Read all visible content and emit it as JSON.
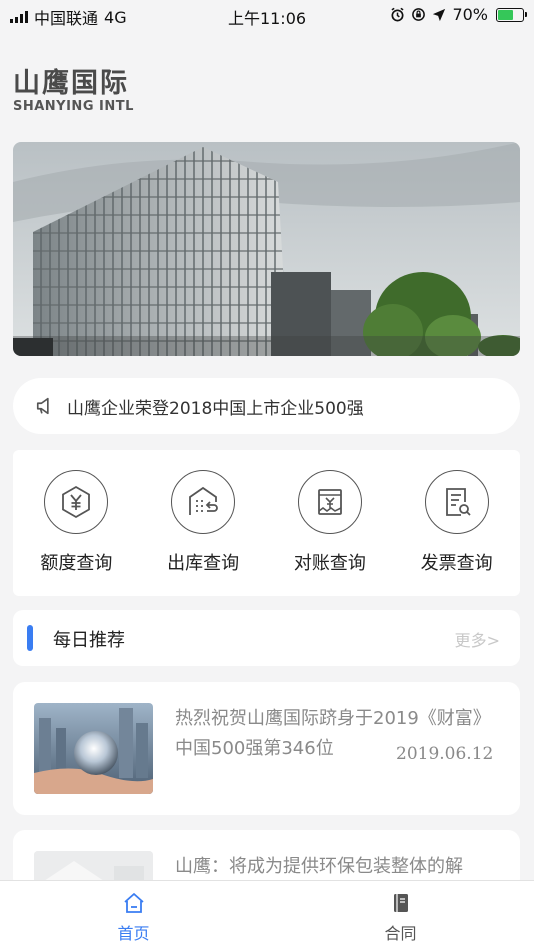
{
  "status_bar": {
    "carrier": "中国联通",
    "network": "4G",
    "time": "上午11:06",
    "battery_percent": "70%",
    "battery_level": 0.7
  },
  "logo": {
    "name_cn": "山鹰国际",
    "name_en": "SHANYING INTL"
  },
  "notice": {
    "text": "山鹰企业荣登2018中国上市企业500强",
    "icon": "megaphone-icon"
  },
  "quick_menu": [
    {
      "label": "额度查询",
      "icon": "yuan-hexagon-icon"
    },
    {
      "label": "出库查询",
      "icon": "warehouse-return-icon"
    },
    {
      "label": "对账查询",
      "icon": "bill-yuan-icon"
    },
    {
      "label": "发票查询",
      "icon": "invoice-search-icon"
    }
  ],
  "section": {
    "title": "每日推荐",
    "more": "更多>",
    "accent_color": "#3a7df2"
  },
  "news": [
    {
      "title": "热烈祝贺山鹰国际跻身于2019《财富》中国500强第346位",
      "date": "2019.06.12"
    },
    {
      "title": "山鹰：将成为提供环保包装整体的解",
      "date": ""
    }
  ],
  "tabbar": {
    "items": [
      {
        "label": "首页",
        "icon": "home-icon",
        "active": true
      },
      {
        "label": "合同",
        "icon": "contract-icon",
        "active": false
      }
    ]
  }
}
